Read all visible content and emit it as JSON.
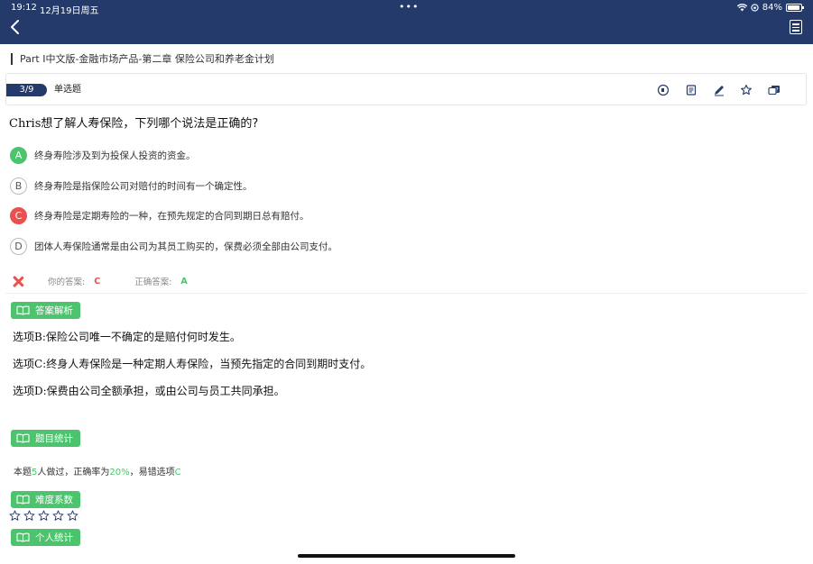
{
  "status": {
    "time": "19:12",
    "date": "12月19日周五",
    "dots": "•••",
    "battery": "84%"
  },
  "breadcrumb": "Part I中文版-金融市场产品-第二章 保险公司和养老金计划",
  "question_card": {
    "number": "3/9",
    "type": "单选题"
  },
  "toolbar_icons": [
    "audio-icon",
    "note-icon",
    "edit-icon",
    "star-icon",
    "question-feedback-icon"
  ],
  "question": {
    "prefix": "Chris",
    "text": "想了解人寿保险，下列哪个说法是正确的?"
  },
  "options": [
    {
      "letter": "A",
      "text": "终身寿险涉及到为投保人投资的资金。",
      "state": "correct"
    },
    {
      "letter": "B",
      "text": "终身寿险是指保险公司对赔付的时间有一个确定性。",
      "state": "normal"
    },
    {
      "letter": "C",
      "text": "终身寿险是定期寿险的一种，在预先规定的合同到期日总有赔付。",
      "state": "wrong"
    },
    {
      "letter": "D",
      "text": "团体人寿保险通常是由公司为其员工购买的，保费必须全部由公司支付。",
      "state": "normal"
    }
  ],
  "answer": {
    "your_label": "你的答案:",
    "your_value": "C",
    "correct_label": "正确答案:",
    "correct_value": "A"
  },
  "analysis": {
    "tag": "答案解析",
    "lines": [
      "选项B:保险公司唯一不确定的是赔付何时发生。",
      "选项C:终身人寿保险是一种定期人寿保险，当预先指定的合同到期时支付。",
      "选项D:保费由公司全额承担，或由公司与员工共同承担。"
    ]
  },
  "statistics": {
    "tag": "题目统计",
    "pre": "本题",
    "count": "5",
    "mid": "人做过，正确率为",
    "rate": "20%",
    "mid2": "，易错选项",
    "wrong_option": "C"
  },
  "difficulty": {
    "tag": "难度系数",
    "rating": 0,
    "max": 5
  },
  "personal": {
    "tag": "个人统计"
  },
  "colors": {
    "header": "#233a6b",
    "correct": "#4cc46d",
    "wrong": "#e8514d"
  }
}
